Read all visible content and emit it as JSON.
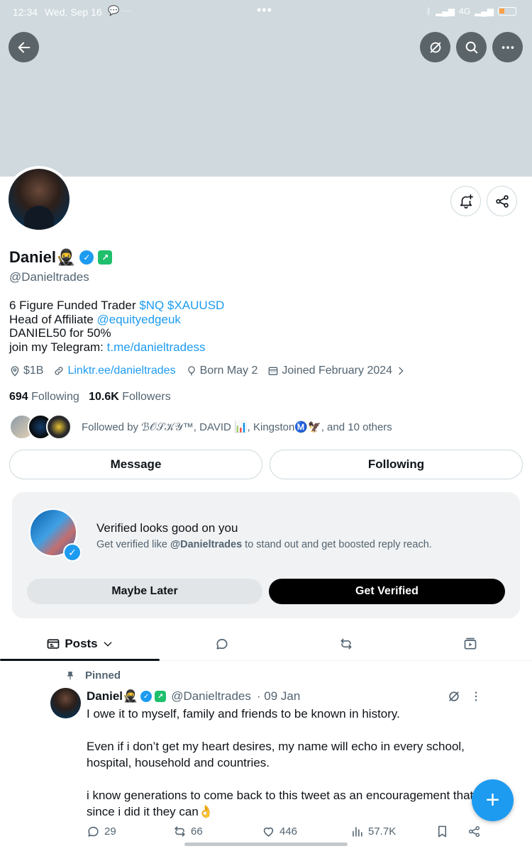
{
  "status_bar": {
    "time": "12:34",
    "date": "Wed, Sep 16",
    "network": "4G",
    "battery": "18"
  },
  "profile": {
    "name": "Daniel🥷",
    "handle": "@Danieltrades",
    "bio": {
      "line1_text": "6 Figure Funded Trader ",
      "line1_link": "$NQ $XAUUSD",
      "line2_text": "Head of Affiliate ",
      "line2_link": "@equityedgeuk",
      "line3_text": "DANIEL50 for 50%",
      "line4_text": "join my Telegram: ",
      "line4_link": "t.me/danieltradess"
    },
    "meta": {
      "location": "$1B",
      "website": "Linktr.ee/danieltrades",
      "birthday": "Born May 2",
      "joined": "Joined February 2024"
    },
    "following_count": "694",
    "following_label": "Following",
    "followers_count": "10.6K",
    "followers_label": "Followers",
    "followed_by": "Followed by ℬ𝒪𝒮𝒦𝒴™, DAVID 📊, KingstonⓂ️🦅, and 10 others"
  },
  "buttons": {
    "message": "Message",
    "following": "Following"
  },
  "verify_card": {
    "title": "Verified looks good on you",
    "sub_prefix": "Get verified like ",
    "sub_handle": "@Danieltrades",
    "sub_suffix": " to stand out and get boosted reply reach.",
    "maybe_later": "Maybe Later",
    "get_verified": "Get Verified"
  },
  "tabs": {
    "posts": "Posts"
  },
  "tweet": {
    "pinned_label": "Pinned",
    "author_name": "Daniel🥷",
    "author_handle": "@Danieltrades",
    "date": "· 09 Jan",
    "text": "I owe it to myself, family and friends to be known in history.\n\nEven if i don’t get my heart desires, my name will echo in every school, hospital, household and countries.\n\ni know generations to come back to this tweet as an encouragement that since i did it they can👌",
    "replies": "29",
    "reposts": "66",
    "likes": "446",
    "views": "57.7K"
  },
  "colors": {
    "accent": "#1d9bf0",
    "text": "#0f1419",
    "muted": "#536471",
    "banner": "#cfd9de"
  }
}
